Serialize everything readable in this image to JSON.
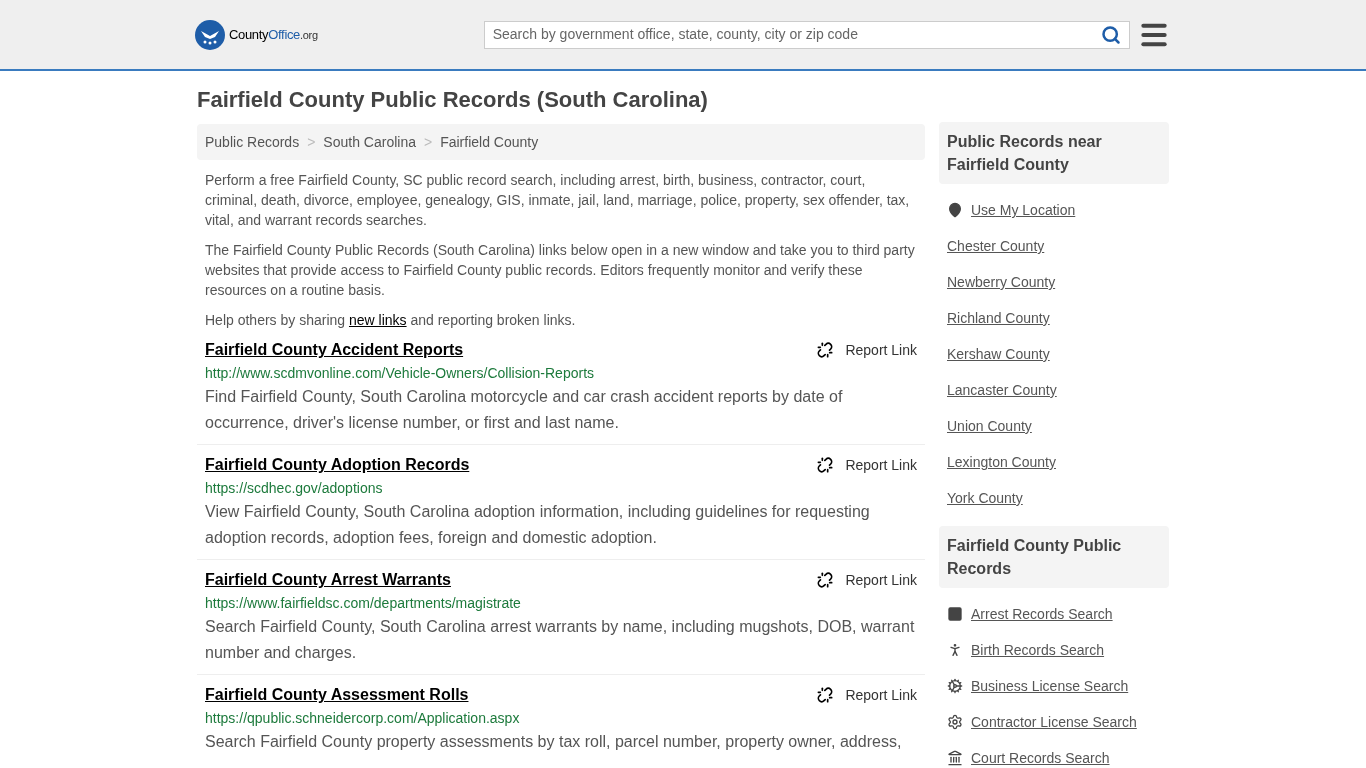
{
  "header": {
    "logo_text": "County",
    "logo_accent": "Office",
    "logo_suffix": ".org",
    "search_placeholder": "Search by government office, state, county, city or zip code"
  },
  "title": "Fairfield County Public Records (South Carolina)",
  "breadcrumbs": [
    "Public Records",
    "South Carolina",
    "Fairfield County"
  ],
  "breadcrumb_separator": ">",
  "intro": [
    "Perform a free Fairfield County, SC public record search, including arrest, birth, business, contractor, court, criminal, death, divorce, employee, genealogy, GIS, inmate, jail, land, marriage, police, property, sex offender, tax, vital, and warrant records searches.",
    "The Fairfield County Public Records (South Carolina) links below open in a new window and take you to third party websites that provide access to Fairfield County public records. Editors frequently monitor and verify these resources on a routine basis."
  ],
  "help": {
    "before": "Help others by sharing",
    "link": "new links",
    "after": "and reporting broken links."
  },
  "records": [
    {
      "title": "Fairfield County Accident Reports",
      "url": "http://www.scdmvonline.com/Vehicle-Owners/Collision-Reports",
      "description": "Find Fairfield County, South Carolina motorcycle and car crash accident reports by date of occurrence, driver's license number, or first and last name.",
      "report": "Report Link"
    },
    {
      "title": "Fairfield County Adoption Records",
      "url": "https://scdhec.gov/adoptions",
      "description": "View Fairfield County, South Carolina adoption information, including guidelines for requesting adoption records, adoption fees, foreign and domestic adoption.",
      "report": "Report Link"
    },
    {
      "title": "Fairfield County Arrest Warrants",
      "url": "https://www.fairfieldsc.com/departments/magistrate",
      "description": "Search Fairfield County, South Carolina arrest warrants by name, including mugshots, DOB, warrant number and charges.",
      "report": "Report Link"
    },
    {
      "title": "Fairfield County Assessment Rolls",
      "url": "https://qpublic.schneidercorp.com/Application.aspx",
      "description": "Search Fairfield County property assessments by tax roll, parcel number, property owner, address,",
      "report": "Report Link"
    }
  ],
  "sidebar": {
    "nearby_title": "Public Records near Fairfield County",
    "location_link": "Use My Location",
    "nearby": [
      "Chester County",
      "Newberry County",
      "Richland County",
      "Kershaw County",
      "Lancaster County",
      "Union County",
      "Lexington County",
      "York County"
    ],
    "records_title": "Fairfield County Public Records",
    "record_links": [
      {
        "kind": "square",
        "label": "Arrest Records Search"
      },
      {
        "kind": "person",
        "label": "Birth Records Search"
      },
      {
        "kind": "gears",
        "label": "Business License Search"
      },
      {
        "kind": "gear",
        "label": "Contractor License Search"
      },
      {
        "kind": "building",
        "label": "Court Records Search"
      }
    ]
  }
}
